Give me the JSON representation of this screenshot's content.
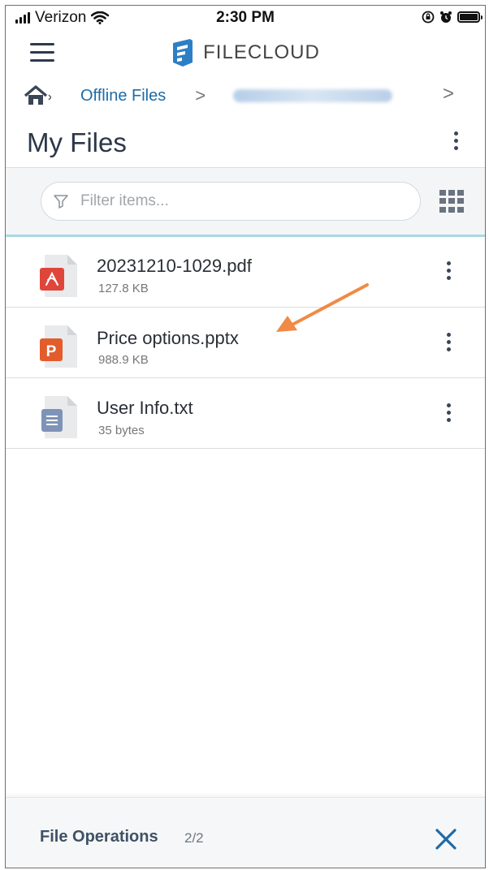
{
  "status_bar": {
    "carrier": "Verizon",
    "time": "2:30 PM"
  },
  "header": {
    "logo_text": "FILECLOUD",
    "menu_icon": "hamburger-icon"
  },
  "breadcrumb": {
    "home_icon": "home-icon",
    "items": [
      "Offline Files"
    ],
    "separator": ">"
  },
  "page": {
    "title": "My Files"
  },
  "filter": {
    "placeholder": "Filter items...",
    "value": ""
  },
  "files": [
    {
      "name": "20231210-1029.pdf",
      "size": "127.8 KB",
      "icon": "pdf-file-icon",
      "icon_label": "",
      "color": "#e0453b"
    },
    {
      "name": "Price options.pptx",
      "size": "988.9 KB",
      "icon": "pptx-file-icon",
      "icon_label": "P",
      "color": "#e35c2b"
    },
    {
      "name": "User Info.txt",
      "size": "35 bytes",
      "icon": "text-file-icon",
      "icon_label": "",
      "color": "#7e93b6"
    }
  ],
  "bottom_panel": {
    "title": "File Operations",
    "count": "2/2"
  },
  "colors": {
    "accent": "#1e6ba8",
    "annotation_arrow": "#f08a45",
    "filter_underline": "#a7d9e4"
  }
}
